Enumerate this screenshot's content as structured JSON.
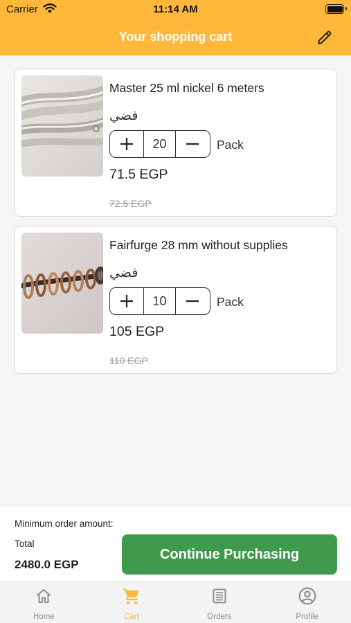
{
  "status_bar": {
    "carrier": "Carrier",
    "time": "11:14 AM"
  },
  "header": {
    "title": "Your shopping cart",
    "edit_icon": "pencil-icon"
  },
  "cart": {
    "items": [
      {
        "name": "Master 25 ml nickel 6 meters",
        "variant": "فضي",
        "quantity": "20",
        "unit": "Pack",
        "price": "71.5 EGP",
        "old_price": "72.5 EGP"
      },
      {
        "name": "Fairfurge 28 mm without supplies",
        "variant": "فضي",
        "quantity": "10",
        "unit": "Pack",
        "price": "105 EGP",
        "old_price": "110 EGP"
      }
    ]
  },
  "summary": {
    "min_order_label": "Minimum order amount:",
    "total_label": "Total",
    "total_value": "2480.0 EGP",
    "continue_label": "Continue Purchasing"
  },
  "tabs": [
    {
      "label": "Home",
      "icon": "home-icon",
      "active": false
    },
    {
      "label": "Cart",
      "icon": "cart-icon",
      "active": true
    },
    {
      "label": "Orders",
      "icon": "orders-icon",
      "active": false
    },
    {
      "label": "Profile",
      "icon": "profile-icon",
      "active": false
    }
  ],
  "colors": {
    "accent": "#ffb83a",
    "button": "#3f9a4e",
    "tab_inactive": "#8e8e8e"
  }
}
